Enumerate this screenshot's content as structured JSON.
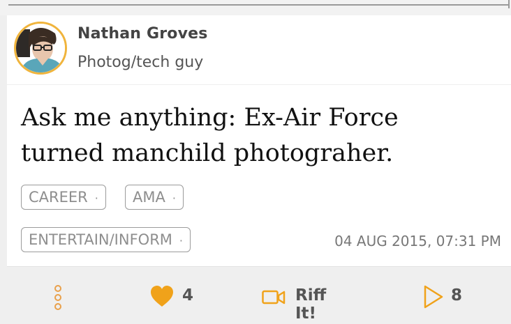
{
  "author": {
    "name": "Nathan Groves",
    "bio": "Photog/tech guy"
  },
  "post": {
    "title_line1": "Ask me anything: Ex-Air Force",
    "title_line2": "turned manchild photograher.",
    "tags": [
      "CAREER",
      "AMA",
      "ENTERTAIN/INFORM"
    ],
    "timestamp": "04 AUG 2015, 07:31 PM"
  },
  "actions": {
    "like_count": "4",
    "riff_label": "Riff It!",
    "play_count": "8"
  },
  "colors": {
    "accent": "#f0a21a",
    "avatar_ring": "#f0b43c",
    "more_icon": "#e9a04a"
  },
  "icons": {
    "more": "vertical-dots-icon",
    "like": "heart-icon",
    "riff": "video-camera-icon",
    "play": "play-icon"
  }
}
